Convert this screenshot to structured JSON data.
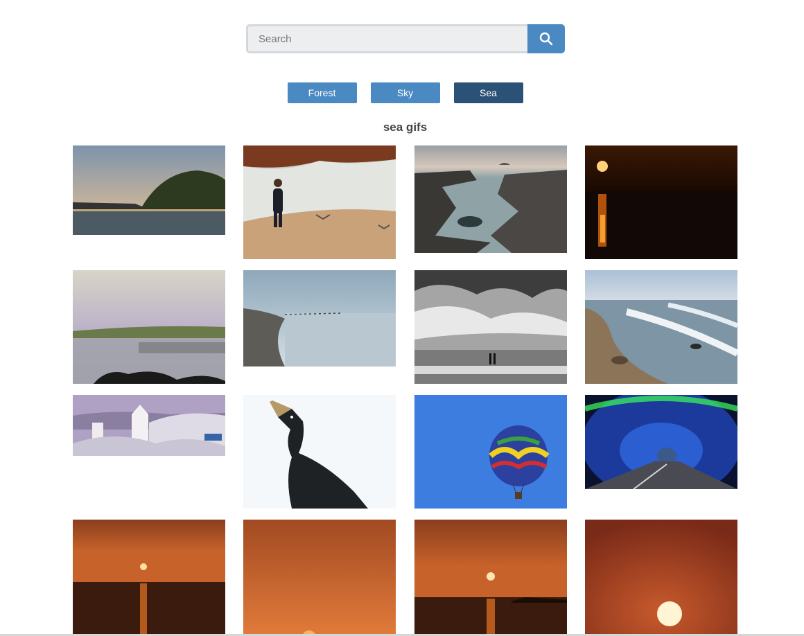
{
  "search": {
    "placeholder": "Search",
    "button_icon": "search-icon"
  },
  "tabs": [
    {
      "label": "Forest",
      "active": false
    },
    {
      "label": "Sky",
      "active": false
    },
    {
      "label": "Sea",
      "active": true
    }
  ],
  "heading": "sea gifs",
  "colors": {
    "accent": "#4b89c2",
    "accent_active": "#2c5177",
    "search_bg": "#eceef0"
  },
  "gallery": [
    {
      "subject": "rocky island at dusk"
    },
    {
      "subject": "man walking on beach with seagulls"
    },
    {
      "subject": "rocky coastline with rock pools"
    },
    {
      "subject": "sunset reflecting over dark sea"
    },
    {
      "subject": "calm lake with jetty"
    },
    {
      "subject": "misty shoreline"
    },
    {
      "subject": "black and white beach with figures under clouds"
    },
    {
      "subject": "waves breaking on stony beach"
    },
    {
      "subject": "white chapel bell tower over seaside village"
    },
    {
      "subject": "cormorant bird"
    },
    {
      "subject": "hot air balloon in blue sky"
    },
    {
      "subject": "lit tunnel with road"
    },
    {
      "subject": "orange sunset over sea"
    },
    {
      "subject": "orange sky with sun on horizon"
    },
    {
      "subject": "sunset over sea with island"
    },
    {
      "subject": "large setting sun in red sky"
    }
  ]
}
